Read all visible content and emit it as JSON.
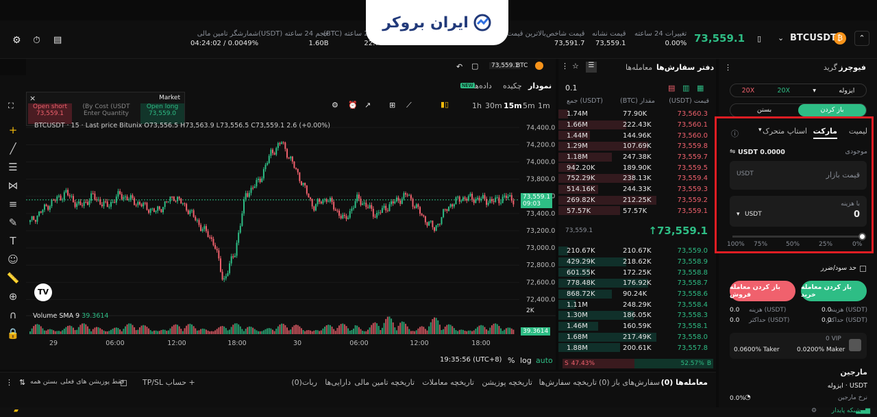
{
  "brand": {
    "name": "ایران بروکر"
  },
  "header": {
    "symbol": "BTCUSDT",
    "price": "73,559.1",
    "stats": [
      {
        "label": "تغییرات 24 ساعته",
        "value": "0.00%"
      },
      {
        "label": "قیمت نشانه",
        "value": "73,559.1"
      },
      {
        "label": "قیمت شاخص",
        "value": "73,591.7"
      },
      {
        "label": "بالاترین قیمت",
        "value": ""
      },
      {
        "label": "(BTC) حجم 24 ساعته",
        "value": "22.77K"
      },
      {
        "label": "(USDT) حجم 24 ساعته",
        "value": "1.60B"
      },
      {
        "label": "شمارشگر تامین مالی",
        "value": "04:24:02 / 0.0049%"
      }
    ]
  },
  "chart": {
    "tabs": [
      "نمودار",
      "چکیده",
      "داده‌ها"
    ],
    "new_badge": "NEW",
    "intervals": [
      "1m",
      "5m",
      "15m",
      "30m",
      "1h"
    ],
    "active_interval": "15m",
    "price_tag": "73,559.1",
    "ticker": "BTC",
    "ohlc_line": "BTCUSDT · 15 · Last price Bitunix  O73,556.5 H73,563.9 L73,556.5 C73,559.1 2.6 (+0.00%)",
    "volume_label": "Volume SMA 9",
    "volume_value": "39.3614",
    "time": "19:35:56 (UTC+8)",
    "options": [
      "%",
      "log",
      "auto"
    ],
    "current_price": "73,559.1",
    "current_time": "09:03",
    "market_widget": {
      "title": "Market",
      "short": "Open short",
      "short_price": "73,559.1",
      "long": "Open long",
      "long_price": "73,559.0",
      "cost_label": "(By Cost (USDT",
      "qty_placeholder": "Enter Quantity"
    }
  },
  "chart_data": {
    "type": "candlestick",
    "y_ticks": [
      "74,400.0",
      "74,200.0",
      "74,000.0",
      "73,800.0",
      "73,600.0",
      "73,400.0",
      "73,200.0",
      "73,000.0",
      "72,800.0",
      "72,600.0",
      "72,400.0"
    ],
    "ylim": [
      72300,
      74450
    ],
    "x_ticks": [
      "29",
      "06:00",
      "12:00",
      "18:00",
      "30",
      "06:00",
      "12:00",
      "18:00"
    ],
    "volume_axis": "2K"
  },
  "orderbook": {
    "tabs": [
      "دفتر سفارش‌ها",
      "معامله‌ها"
    ],
    "precision": "0.1",
    "columns": [
      "(USDT) قیمت",
      "(BTC) مقدار",
      "جمع (USDT)"
    ],
    "asks": [
      [
        "73,560.3",
        "77.90K",
        "1.74M"
      ],
      [
        "73,560.1",
        "222.43K",
        "1.66M"
      ],
      [
        "73,560.0",
        "144.96K",
        "1.44M"
      ],
      [
        "73,559.8",
        "107.69K",
        "1.29M"
      ],
      [
        "73,559.7",
        "247.38K",
        "1.18M"
      ],
      [
        "73,559.5",
        "189.90K",
        "942.20K"
      ],
      [
        "73,559.4",
        "238.13K",
        "752.29K"
      ],
      [
        "73,559.3",
        "244.33K",
        "514.16K"
      ],
      [
        "73,559.2",
        "212.25K",
        "269.82K"
      ],
      [
        "73,559.1",
        "57.57K",
        "57.57K"
      ]
    ],
    "mid": "↑73,559.1",
    "mid_small": "73,559.1",
    "bids": [
      [
        "73,559.0",
        "210.67K",
        "210.67K"
      ],
      [
        "73,558.9",
        "218.62K",
        "429.29K"
      ],
      [
        "73,558.8",
        "172.25K",
        "601.55K"
      ],
      [
        "73,558.7",
        "176.92K",
        "778.48K"
      ],
      [
        "73,558.6",
        "90.24K",
        "868.72K"
      ],
      [
        "73,558.4",
        "248.29K",
        "1.11M"
      ],
      [
        "73,558.3",
        "186.05K",
        "1.30M"
      ],
      [
        "73,558.1",
        "160.59K",
        "1.46M"
      ],
      [
        "73,558.0",
        "217.49K",
        "1.68M"
      ],
      [
        "73,557.8",
        "200.61K",
        "1.88M"
      ]
    ],
    "buy_pct": "52.57%",
    "sell_pct": "47.43%",
    "buy_letter": "B",
    "sell_letter": "S"
  },
  "trade": {
    "tabs": [
      "فیوچرز",
      "گرید"
    ],
    "margin_mode": "ایزوله",
    "leverage_long": "20X",
    "leverage_short": "20X",
    "open": "باز کردن",
    "close": "بستن",
    "order_types": [
      "لیمیت",
      "مارکت",
      "استاپ متحرک"
    ],
    "balance_label": "موجودی",
    "balance": "USDT 0.0000",
    "price_placeholder": "قیمت بازار",
    "price_unit": "USDT",
    "cost_label": "با هزینه",
    "cost_value": "0",
    "cost_unit": "USDT",
    "slider": [
      "0%",
      "25%",
      "50%",
      "75%",
      "100%"
    ],
    "tpsl": "حد سود/ضرر",
    "buy_btn": "باز کردن معامله خرید",
    "sell_btn": "باز کردن معامله فروش",
    "cost_buy_label": "هزینه (USDT)",
    "cost_buy": "0.0",
    "cost_sell_label": "هزینه (USDT)",
    "cost_sell": "0.0",
    "max_buy_label": "حداکثر (USDT)",
    "max_buy": "0.0",
    "max_sell_label": "حداکثر (USDT)",
    "max_sell": "0.0",
    "vip": "0 VIP",
    "maker": "0.0200% Maker",
    "taker": "0.0600% Taker",
    "margin_title": "مارجین",
    "margin_mode_label": "ایزوله · USDT",
    "margin_rate_label": "نرخ مارجین",
    "margin_rate": "0.0%"
  },
  "bottom": {
    "tabs": [
      "معامله‌ها (0)",
      "سفارش‌های باز (0)",
      "تاریخچه سفارش‌ها",
      "تاریخچه پوزیشن",
      "تاریخچه معاملات",
      "تاریخچه تامین مالی",
      "دارایی‌ها",
      "ربات(0)"
    ],
    "tpsl": "TP/SL حساب",
    "only_current": "فقط پوزیشن های فعلی",
    "close_all": "بستن همه"
  },
  "footer": {
    "network": "شبکه پایدار"
  }
}
